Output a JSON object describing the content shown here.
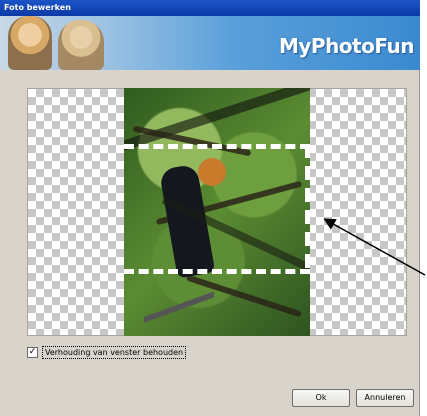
{
  "window": {
    "title": "Foto bewerken"
  },
  "banner": {
    "logo_text": "MyPhotoFun"
  },
  "editor": {
    "checkbox_label": "Verhouding van venster behouden",
    "checkbox_checked": true
  },
  "buttons": {
    "ok": "Ok",
    "cancel": "Annuleren"
  },
  "colors": {
    "title_bar": "#0a3aa6",
    "dialog_bg": "#d8d4cb",
    "crop_marker": "#ffffff"
  }
}
